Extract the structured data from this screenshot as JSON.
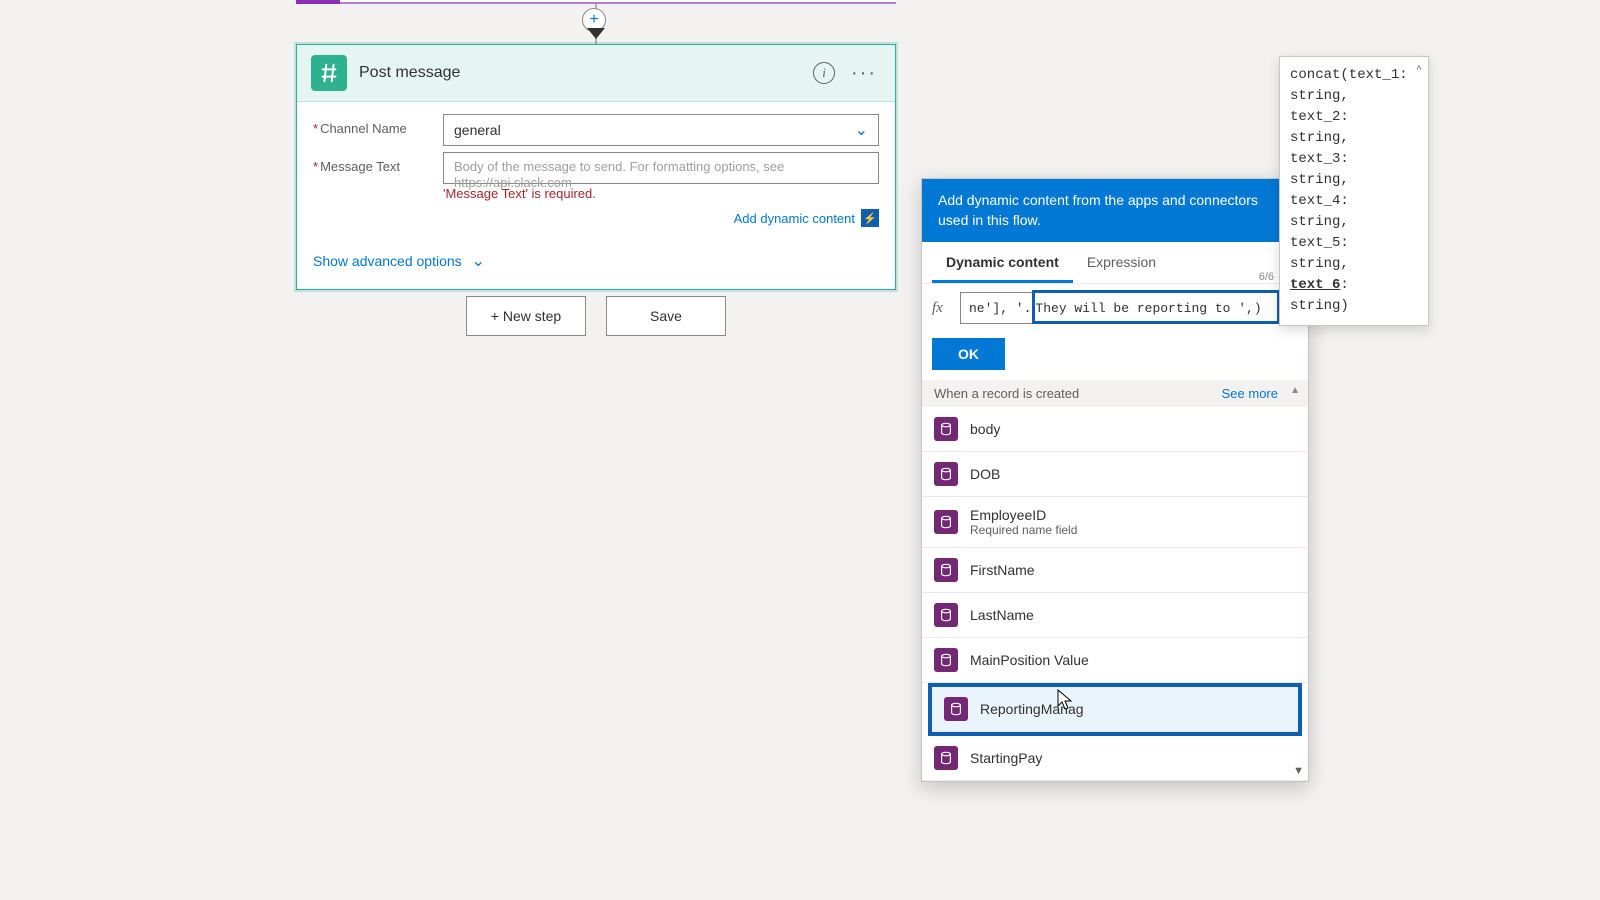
{
  "flow": {
    "plus_label": "+"
  },
  "card": {
    "title": "Post message",
    "info_glyph": "i",
    "dots_glyph": "···",
    "fields": {
      "channel_label": "Channel Name",
      "channel_value": "general",
      "message_label": "Message Text",
      "message_placeholder": "Body of the message to send. For formatting options, see https://api.slack.com",
      "message_error": "'Message Text' is required."
    },
    "add_dynamic": "Add dynamic content",
    "advanced": "Show advanced options"
  },
  "buttons": {
    "new_step": "+ New step",
    "save": "Save"
  },
  "panel": {
    "head": "Add dynamic content from the apps and connectors used in this flow.",
    "tab_dynamic": "Dynamic content",
    "tab_expression": "Expression",
    "counter": "6/6",
    "fx": "fx",
    "expr_left": "ne'], '.",
    "expr_hl": "They will be reporting to ', ",
    "expr_right": ")",
    "ok": "OK",
    "group": "When a record is created",
    "see_more": "See more",
    "items": [
      {
        "label": "body"
      },
      {
        "label": "DOB"
      },
      {
        "label": "EmployeeID",
        "sub": "Required name field"
      },
      {
        "label": "FirstName"
      },
      {
        "label": "LastName"
      },
      {
        "label": "MainPosition Value"
      },
      {
        "label": "ReportingManag",
        "selected": true
      },
      {
        "label": "StartingPay"
      }
    ]
  },
  "sig": {
    "text_lines": [
      "concat(text_1:",
      "string,",
      "text_2:",
      "string,",
      "text_3:",
      "string,",
      "text_4:",
      "string,",
      "text_5:",
      "string,"
    ],
    "active_arg": "text_6",
    "tail": ":\nstring)"
  }
}
